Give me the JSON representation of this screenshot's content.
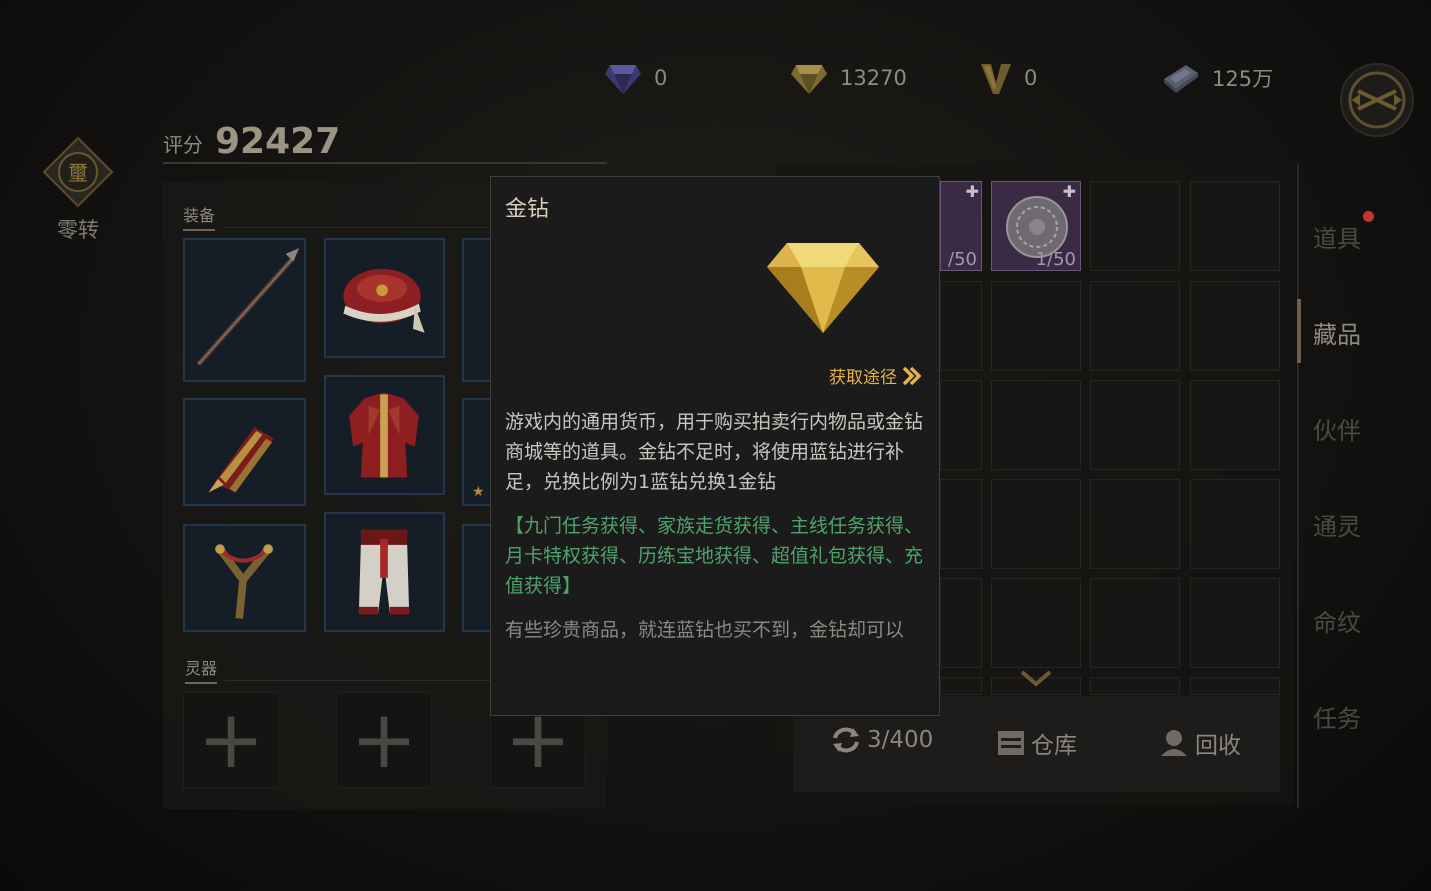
{
  "currencies": {
    "blue_diamond": {
      "icon": "blue-diamond-icon",
      "value": "0"
    },
    "gold_diamond": {
      "icon": "gold-diamond-icon",
      "value": "13270"
    },
    "v_point": {
      "icon": "v-icon",
      "value": "0"
    },
    "silver": {
      "icon": "silver-ingot-icon",
      "value": "125万"
    }
  },
  "rebirth": {
    "glyph": "璽",
    "label": "零转"
  },
  "score": {
    "label": "评分",
    "value": "92427"
  },
  "equipment": {
    "section_title": "装备",
    "spirit_title": "灵器",
    "spirit_slot_glyph": "+"
  },
  "grid": {
    "slot_counts": [
      "/50",
      "1/50"
    ]
  },
  "bottom_bar": {
    "capacity": "3/400",
    "warehouse": "仓库",
    "recycle": "回收"
  },
  "tabs": [
    "道具",
    "藏品",
    "伙伴",
    "通灵",
    "命纹",
    "任务"
  ],
  "active_tab": "藏品",
  "tooltip": {
    "title": "金钻",
    "source_link": "获取途径",
    "description": "游戏内的通用货币，用于购买拍卖行内物品或金钻商城等的道具。金钻不足时，将使用蓝钻进行补足，兑换比例为1蓝钻兑换1金钻",
    "sources": "【九门任务获得、家族走货获得、主线任务获得、月卡特权获得、历练宝地获得、超值礼包获得、充值获得】",
    "flavor": "有些珍贵商品，就连蓝钻也买不到，金钻却可以"
  },
  "colors": {
    "gold_accent": "#e3b24a",
    "source_green": "#4ea36a",
    "notification_red": "#c73333"
  }
}
